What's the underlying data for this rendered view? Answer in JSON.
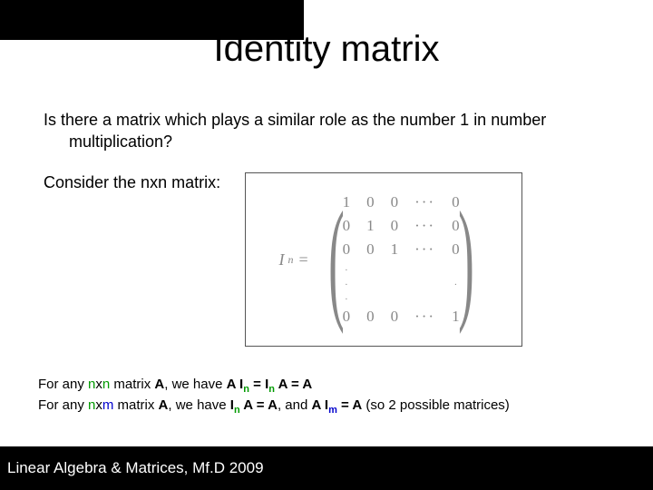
{
  "title": "Identity matrix",
  "question_l1": "Is there a matrix which plays a similar role as the number 1 in number",
  "question_l2": "multiplication?",
  "consider": "Consider the nxn matrix:",
  "matrix": {
    "label_I": "I",
    "label_n": "n",
    "eq": "=",
    "rows": [
      [
        "1",
        "0",
        "0",
        "···",
        "0"
      ],
      [
        "0",
        "1",
        "0",
        "···",
        "0"
      ],
      [
        "0",
        "0",
        "1",
        "···",
        "0"
      ],
      [
        ".",
        "",
        "",
        "",
        ""
      ],
      [
        ".",
        "",
        "",
        "",
        "."
      ],
      [
        ".",
        "",
        "",
        "",
        ""
      ],
      [
        "0",
        "0",
        "0",
        "···",
        "1"
      ]
    ]
  },
  "foot": {
    "f1_a": "For any ",
    "f1_n1": "n",
    "f1_x1": "x",
    "f1_n2": "n",
    "f1_b": " matrix ",
    "f1_A": "A",
    "f1_c": ", we have  ",
    "f1_A2": "A I",
    "f1_sub1": "n",
    "f1_eq1": " = I",
    "f1_sub2": "n",
    "f1_A3": " A = A",
    "f2_a": "For any ",
    "f2_n1": "n",
    "f2_x1": "x",
    "f2_m1": "m",
    "f2_b": " matrix ",
    "f2_A": "A",
    "f2_c": ", we have ",
    "f2_I": "I",
    "f2_sub1": "n",
    "f2_A2": " A = A",
    "f2_d": ", and  ",
    "f2_A3": "A I",
    "f2_sub2": "m",
    "f2_eq": " = A",
    "f2_e": " (so 2 possible matrices)"
  },
  "footer": "Linear Algebra & Matrices, Mf.D 2009"
}
